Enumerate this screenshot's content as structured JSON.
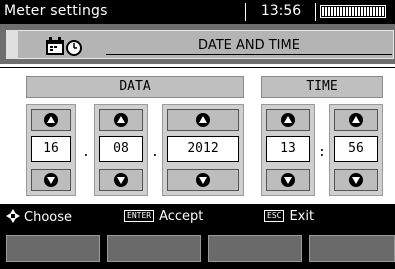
{
  "titlebar": {
    "title": "Meter settings",
    "time": "13:56",
    "battery_icon": "battery-icon"
  },
  "header": {
    "title": "DATE AND TIME",
    "icon": "calendar-clock-icon"
  },
  "date": {
    "label": "DATA",
    "day": "16",
    "month": "08",
    "year": "2012",
    "separator": "."
  },
  "time": {
    "label": "TIME",
    "hour": "13",
    "minute": "56",
    "separator": ":"
  },
  "hints": {
    "choose": "Choose",
    "enter_key": "ENTER",
    "accept": "Accept",
    "esc_key": "ESC",
    "exit": "Exit"
  },
  "colors": {
    "bar": "#000000",
    "header_bg": "#6e6e6e",
    "panel": "#cfcfcf",
    "fkey": "#6a6a6a"
  }
}
